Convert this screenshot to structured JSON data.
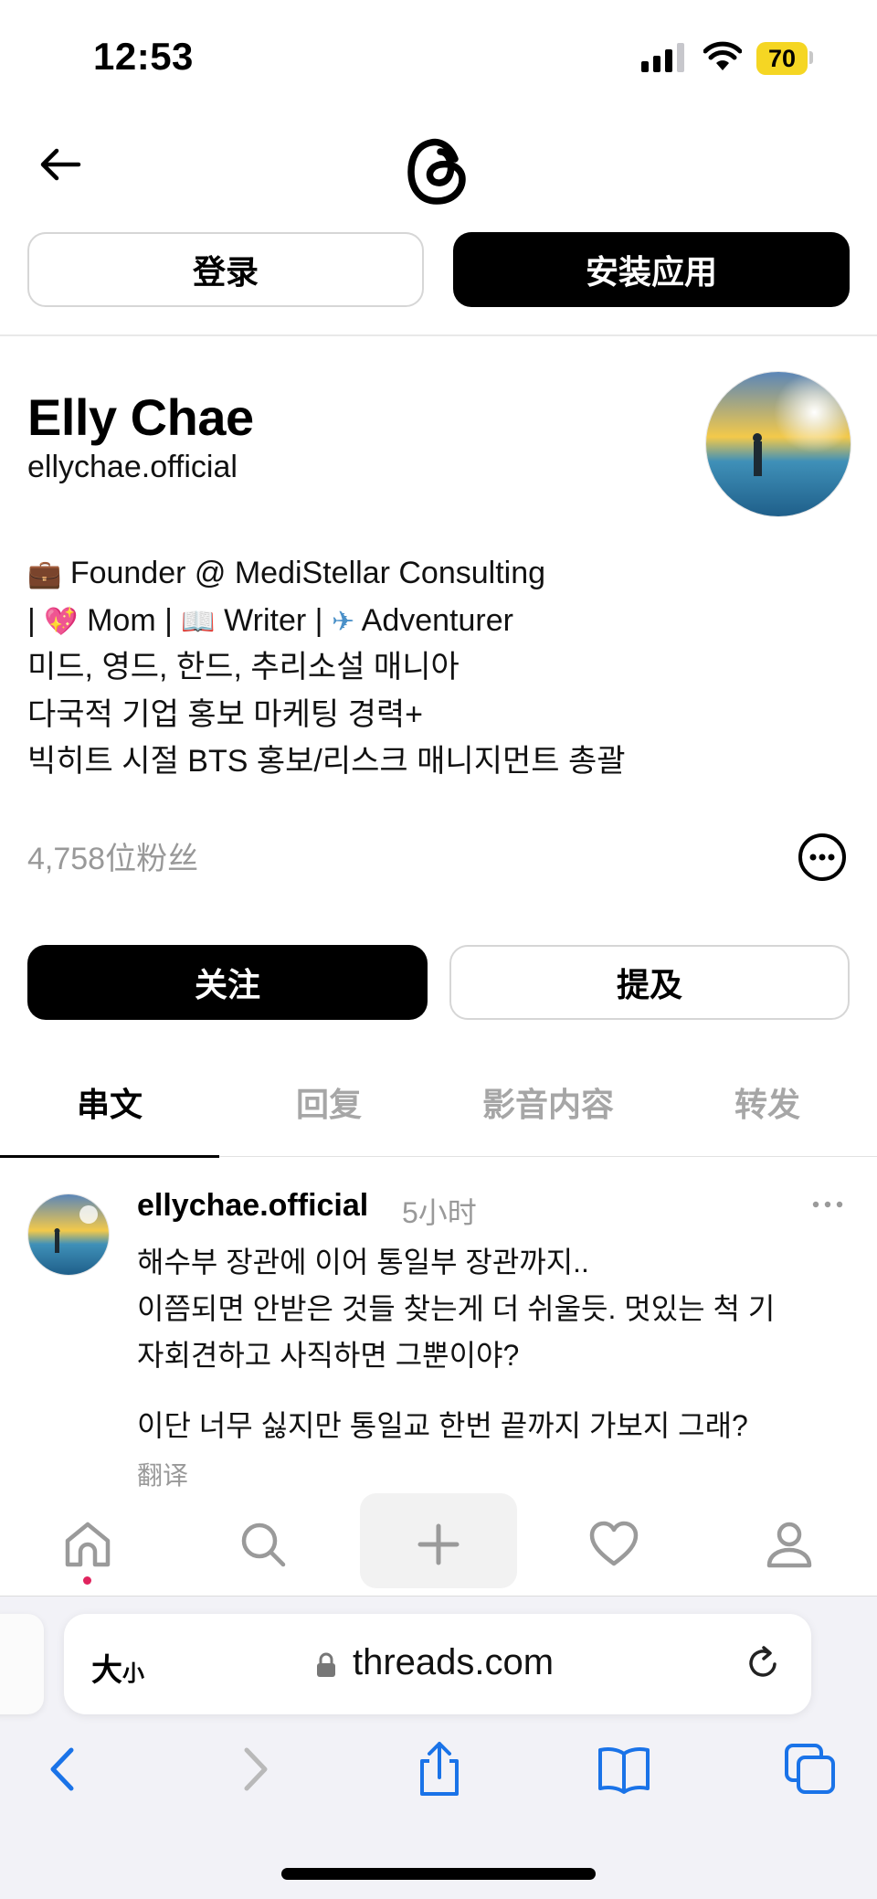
{
  "status_bar": {
    "time": "12:53",
    "battery": "70"
  },
  "header": {
    "login_label": "登录",
    "install_label": "安装应用"
  },
  "profile": {
    "name": "Elly Chae",
    "handle": "ellychae.official",
    "bio": {
      "line1_text": "Founder @ MediStellar Consulting",
      "line2_a": "| ",
      "line2_b": " Mom | ",
      "line2_c": " Writer | ",
      "line2_d": " Adventurer",
      "line3": "미드, 영드, 한드, 추리소설 매니아",
      "line4": "다국적 기업 홍보 마케팅 경력+",
      "line5": "빅히트 시절 BTS 홍보/리스크 매니지먼트 총괄"
    },
    "followers": "4,758位粉丝",
    "follow_label": "关注",
    "mention_label": "提及"
  },
  "tabs": [
    "串文",
    "回复",
    "影音内容",
    "转发"
  ],
  "post": {
    "username": "ellychae.official",
    "time": "5小时",
    "lines": [
      "해수부 장관에 이어 통일부 장관까지..",
      "이쯤되면 안받은 것들 찾는게 더 쉬울듯. 멋있는 척 기",
      "자회견하고 사직하면 그뿐이야?"
    ],
    "line2": "이단 너무 싫지만 통일교 한번 끝까지 가보지 그래?",
    "translate": "翻译"
  },
  "browser": {
    "text_size_big": "大",
    "text_size_small": "小",
    "url": "threads.com"
  },
  "icons": {
    "bio_line1": "briefcase-icon",
    "bio_line2": [
      "sparkling-heart-icon",
      "open-book-icon",
      "airplane-icon"
    ],
    "header": [
      "back-arrow-icon",
      "threads-logo-icon"
    ],
    "nav": [
      "home-icon",
      "search-icon",
      "plus-icon",
      "heart-icon",
      "profile-icon"
    ],
    "safari": [
      "chevron-left-icon",
      "chevron-right-icon",
      "share-icon",
      "bookmarks-icon",
      "tabs-icon",
      "lock-icon",
      "reload-icon"
    ]
  },
  "colors": {
    "primary": "#000000",
    "muted": "#999999",
    "battery": "#f5d623",
    "safari_blue": "#1a73e8",
    "notification_dot": "#e0245e"
  }
}
